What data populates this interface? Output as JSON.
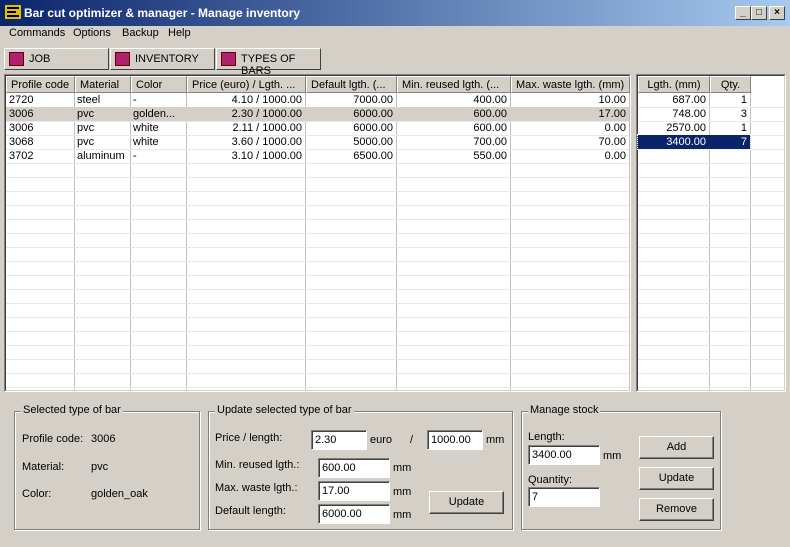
{
  "window": {
    "title": "Bar cut optimizer & manager - Manage inventory"
  },
  "menu": [
    "Commands",
    "Options",
    "Backup",
    "Help"
  ],
  "tabs": [
    {
      "label": "JOB",
      "icon": "hand-icon"
    },
    {
      "label": "INVENTORY",
      "icon": "document-icon"
    },
    {
      "label": "TYPES OF BARS",
      "icon": "bars-icon"
    }
  ],
  "types_table": {
    "headers": [
      "Profile code",
      "Material",
      "Color",
      "Price (euro) / Lgth. ...",
      "Default lgth. (...",
      "Min. reused lgth. (...",
      "Max. waste lgth. (mm)"
    ],
    "rows": [
      [
        "2720",
        "steel",
        "-",
        "4.10 / 1000.00",
        "7000.00",
        "400.00",
        "10.00"
      ],
      [
        "3006",
        "pvc",
        "golden...",
        "2.30 / 1000.00",
        "6000.00",
        "600.00",
        "17.00"
      ],
      [
        "3006",
        "pvc",
        "white",
        "2.11 / 1000.00",
        "6000.00",
        "600.00",
        "0.00"
      ],
      [
        "3068",
        "pvc",
        "white",
        "3.60 / 1000.00",
        "5000.00",
        "700.00",
        "70.00"
      ],
      [
        "3702",
        "aluminum",
        "-",
        "3.10 / 1000.00",
        "6500.00",
        "550.00",
        "0.00"
      ]
    ],
    "selected_row": 1
  },
  "stock_table": {
    "headers": [
      "Lgth. (mm)",
      "Qty."
    ],
    "rows": [
      [
        "687.00",
        "1"
      ],
      [
        "748.00",
        "3"
      ],
      [
        "2570.00",
        "1"
      ],
      [
        "3400.00",
        "7"
      ]
    ],
    "selected_row": 3
  },
  "selected_type": {
    "group_title": "Selected type of bar",
    "profile_label": "Profile code:",
    "profile_value": "3006",
    "material_label": "Material:",
    "material_value": "pvc",
    "color_label": "Color:",
    "color_value": "golden_oak"
  },
  "update_type": {
    "group_title": "Update selected type of bar",
    "price_label": "Price / length:",
    "price_value": "2.30",
    "price_unit": "euro",
    "slash": "/",
    "length_value": "1000.00",
    "length_unit": "mm",
    "min_label": "Min. reused lgth.:",
    "min_value": "600.00",
    "min_unit": "mm",
    "waste_label": "Max. waste lgth.:",
    "waste_value": "17.00",
    "waste_unit": "mm",
    "default_label": "Default length:",
    "default_value": "6000.00",
    "default_unit": "mm",
    "update_button": "Update"
  },
  "manage_stock": {
    "group_title": "Manage stock",
    "length_label": "Length:",
    "length_value": "3400.00",
    "length_unit": "mm",
    "qty_label": "Quantity:",
    "qty_value": "7",
    "add_button": "Add",
    "update_button": "Update",
    "remove_button": "Remove"
  },
  "colors": {
    "selection": "#0a246a",
    "row_highlight": "#d4d0c8",
    "tab_icon": "#b0216e"
  }
}
